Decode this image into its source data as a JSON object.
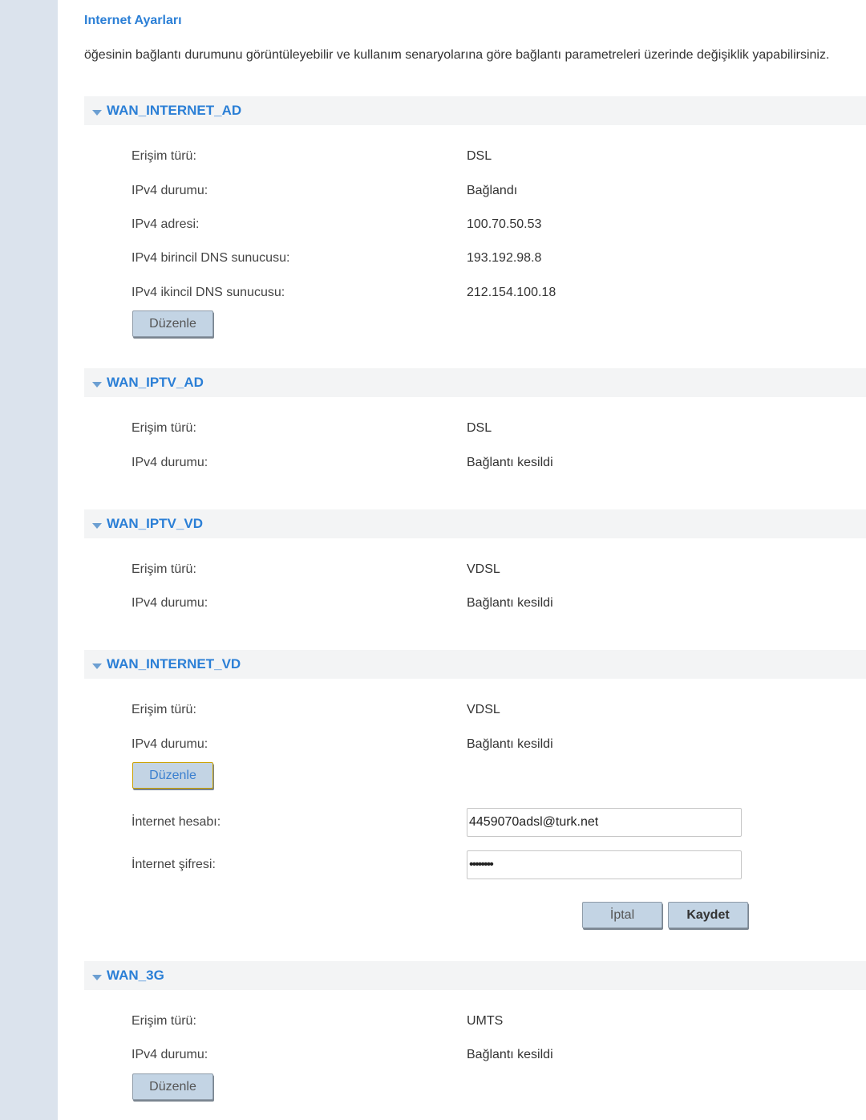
{
  "page": {
    "title": "Internet Ayarları",
    "description": "öğesinin bağlantı durumunu görüntüleyebilir ve kullanım senaryolarına göre bağlantı parametreleri üzerinde değişiklik yapabilirsiniz."
  },
  "labels": {
    "access_type": "Erişim türü:",
    "ipv4_status": "IPv4 durumu:",
    "ipv4_address": "IPv4 adresi:",
    "ipv4_primary_dns": "IPv4 birincil DNS sunucusu:",
    "ipv4_secondary_dns": "IPv4 ikincil DNS sunucusu:",
    "internet_account": "İnternet hesabı:",
    "internet_password": "İnternet şifresi:"
  },
  "buttons": {
    "edit": "Düzenle",
    "cancel": "İptal",
    "save": "Kaydet"
  },
  "sections": [
    {
      "name": "WAN_INTERNET_AD",
      "access_type": "DSL",
      "ipv4_status": "Bağlandı",
      "ipv4_address": "100.70.50.53",
      "primary_dns": "193.192.98.8",
      "secondary_dns": "212.154.100.18"
    },
    {
      "name": "WAN_IPTV_AD",
      "access_type": "DSL",
      "ipv4_status": "Bağlantı kesildi"
    },
    {
      "name": "WAN_IPTV_VD",
      "access_type": "VDSL",
      "ipv4_status": "Bağlantı kesildi"
    },
    {
      "name": "WAN_INTERNET_VD",
      "access_type": "VDSL",
      "ipv4_status": "Bağlantı kesildi",
      "internet_account": "4459070adsl@turk.net",
      "internet_password": "••••••••"
    },
    {
      "name": "WAN_3G",
      "access_type": "UMTS",
      "ipv4_status": "Bağlantı kesildi"
    }
  ]
}
